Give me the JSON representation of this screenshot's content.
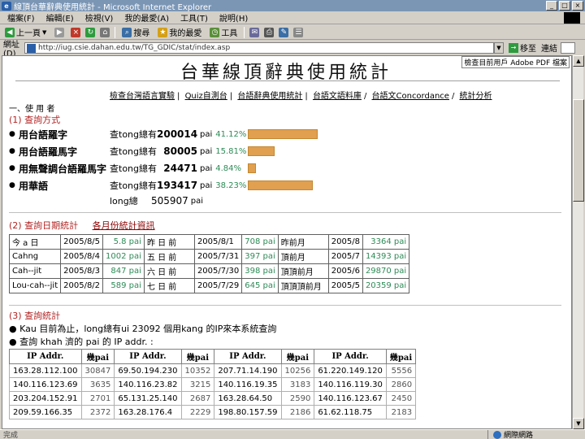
{
  "window": {
    "title": "線頂台華辭典使用統計 - Microsoft Internet Explorer"
  },
  "menu": [
    "檔案(F)",
    "編輯(E)",
    "檢視(V)",
    "我的最愛(A)",
    "工具(T)",
    "說明(H)"
  ],
  "toolbar": {
    "back": "上一頁",
    "search": "搜尋",
    "favorites": "我的最愛",
    "tools": "工具"
  },
  "address": {
    "label": "網址(D)",
    "url": "http://iug.csie.dahan.edu.tw/TG_GDIC/stat/index.asp",
    "go": "移至",
    "links": "連結"
  },
  "page": {
    "banner_link": "檢查目前用戶 Adobe PDF 檔案",
    "title": "台華線頂辭典使用統計",
    "nav": [
      "檢查台灣語言實驗",
      "Quiz自測台",
      "台語辭典使用統計",
      "台語文語料庫",
      "台語文Concordance",
      "統計分析"
    ],
    "section_label": "一、使 用 者",
    "heading1": "(1) 查詢方式",
    "usage": [
      {
        "name": "用台語羅字",
        "text": "查tong總有",
        "count": "200014",
        "unit": "pai",
        "pct": "41.12%",
        "fraction": 0.4112
      },
      {
        "name": "用台語羅馬字",
        "text": "查tong總有",
        "count": "80005",
        "unit": "pai",
        "pct": "15.81%",
        "fraction": 0.1581
      },
      {
        "name": "用無聲調台語羅馬字",
        "text": "查tong總有",
        "count": "24471",
        "unit": "pai",
        "pct": "4.84%",
        "fraction": 0.0484
      },
      {
        "name": "用華語",
        "text": "查tong總有",
        "count": "193417",
        "unit": "pai",
        "pct": "38.23%",
        "fraction": 0.3823
      }
    ],
    "total_label": "long總",
    "total_count": "505907",
    "total_unit": "pai",
    "heading2": "(2) 查詢日期統計",
    "heading2_sub": "各月份統計資訊",
    "stats": [
      [
        "今 a 日",
        "2005/8/5",
        "5.8 pai",
        "昨 日 前",
        "2005/8/1",
        "708 pai",
        "昨前月",
        "2005/8",
        "3364 pai"
      ],
      [
        "Cahng",
        "2005/8/4",
        "1002 pai",
        "五 日 前",
        "2005/7/31",
        "397 pai",
        "頂前月",
        "2005/7",
        "14393 pai"
      ],
      [
        "Cah--jit",
        "2005/8/3",
        "847 pai",
        "六 日 前",
        "2005/7/30",
        "398 pai",
        "頂頂前月",
        "2005/6",
        "29870 pai"
      ],
      [
        "Lou-cah--jit",
        "2005/8/2",
        "589 pai",
        "七 日 前",
        "2005/7/29",
        "645 pai",
        "頂頂頂前月",
        "2005/5",
        "20359 pai"
      ]
    ],
    "heading3": "(3) 查詢統計",
    "query1": "Kau 目前為止，long總有ui 23092 個用kang 的IP來本系統查詢",
    "query2": "查詢 khah 濟的 pai 的 IP addr. :",
    "ip_headers": [
      "IP Addr.",
      "幾pai",
      "IP Addr.",
      "幾pai",
      "IP Addr.",
      "幾pai",
      "IP Addr.",
      "幾pai"
    ],
    "ip_rows": [
      [
        "163.28.112.100",
        "30847",
        "69.50.194.230",
        "10352",
        "207.71.14.190",
        "10256",
        "61.220.149.120",
        "5556"
      ],
      [
        "140.116.123.69",
        "3635",
        "140.116.23.82",
        "3215",
        "140.116.19.35",
        "3183",
        "140.116.119.30",
        "2860"
      ],
      [
        "203.204.152.91",
        "2701",
        "65.131.25.140",
        "2687",
        "163.28.64.50",
        "2590",
        "140.116.123.67",
        "2450"
      ],
      [
        "209.59.166.35",
        "2372",
        "163.28.176.4",
        "2229",
        "198.80.157.59",
        "2186",
        "61.62.118.75",
        "2183"
      ]
    ]
  },
  "status": {
    "left": "完成",
    "zone": "網際網路"
  }
}
